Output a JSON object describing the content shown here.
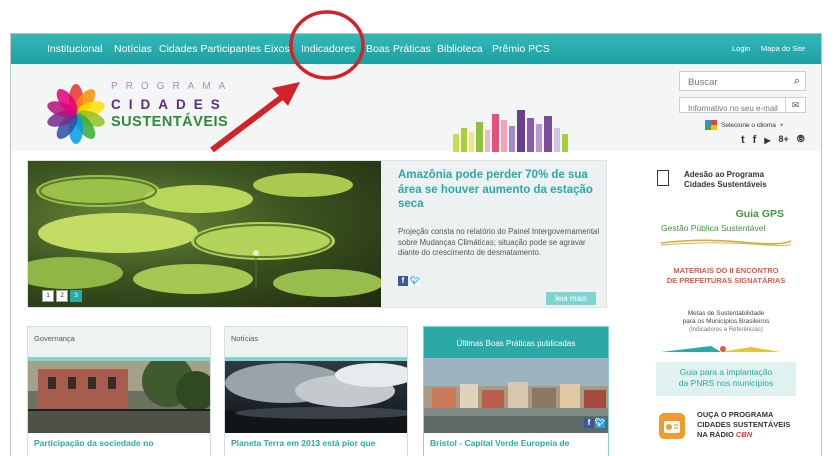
{
  "nav": {
    "items": [
      "Institucional",
      "Notícias",
      "Cidades Participantes",
      "Eixos",
      "Indicadores",
      "Boas Práticas",
      "Biblioteca",
      "Prêmio PCS"
    ],
    "login": "Login",
    "sitemap": "Mapa do Site"
  },
  "logo": {
    "line1": "PROGRAMA",
    "line2": "CIDADES",
    "line3": "SUSTENTÁVEIS"
  },
  "search": {
    "placeholder": "Buscar"
  },
  "newsletter": {
    "placeholder": "Informativo no seu e-mail"
  },
  "language": {
    "label": "Selecione o idioma"
  },
  "social_icons": [
    "tumblr-icon",
    "facebook-icon",
    "youtube-icon",
    "google-plus-icon",
    "rss-icon"
  ],
  "hero": {
    "title": "Amazônia pode perder 70% de sua área se houver aumento da estação seca",
    "text": "Projeção consta no relatório do Painel Intergovernamental sobre Mudanças Climáticas; situação pode se agravar diante do crescimento de desmatamento.",
    "read_more": "leia mais",
    "pages": [
      "1",
      "2",
      "3"
    ],
    "active_page": "3"
  },
  "cards": [
    {
      "header": "Governança",
      "caption": "Participação da sociedade no"
    },
    {
      "header": "Notícias",
      "caption": "Planeta Terra em 2013 está pior que"
    },
    {
      "header": "Últimas Boas Práticas publicadas",
      "caption": "Bristol - Capital Verde Europeia de"
    }
  ],
  "sidebar": {
    "adesao_line1": "Adesão ao Programa",
    "adesao_line2": "Cidades Sustentáveis",
    "gps_title": "Guia GPS",
    "gps_sub": "Gestão Pública Sustentável",
    "materiais_line1": "MATERIAIS DO II ENCONTRO",
    "materiais_line2": "DE PREFEITURAS SIGNATÁRIAS",
    "metas_line1": "Metas de Sustentabilidade",
    "metas_line2": "para os Municípios Brasileiros",
    "metas_line3": "(Indicadores e Referências)",
    "pnrs_line1": "Guia para a implantação",
    "pnrs_line2": "da PNRS nos municípios",
    "radio_line1": "OUÇA O PROGRAMA",
    "radio_line2": "CIDADES SUSTENTÁVEIS",
    "radio_line3_a": "NA RÁDIO",
    "radio_line3_b": "CBN"
  },
  "colors": {
    "nav_teal": "#2aa9a6",
    "accent_teal": "#2aa9a6",
    "light_teal": "#7fd3d1",
    "annotation_red": "#d2232a",
    "logo_purple": "#5a2f7a",
    "logo_green": "#2c8a3b"
  }
}
